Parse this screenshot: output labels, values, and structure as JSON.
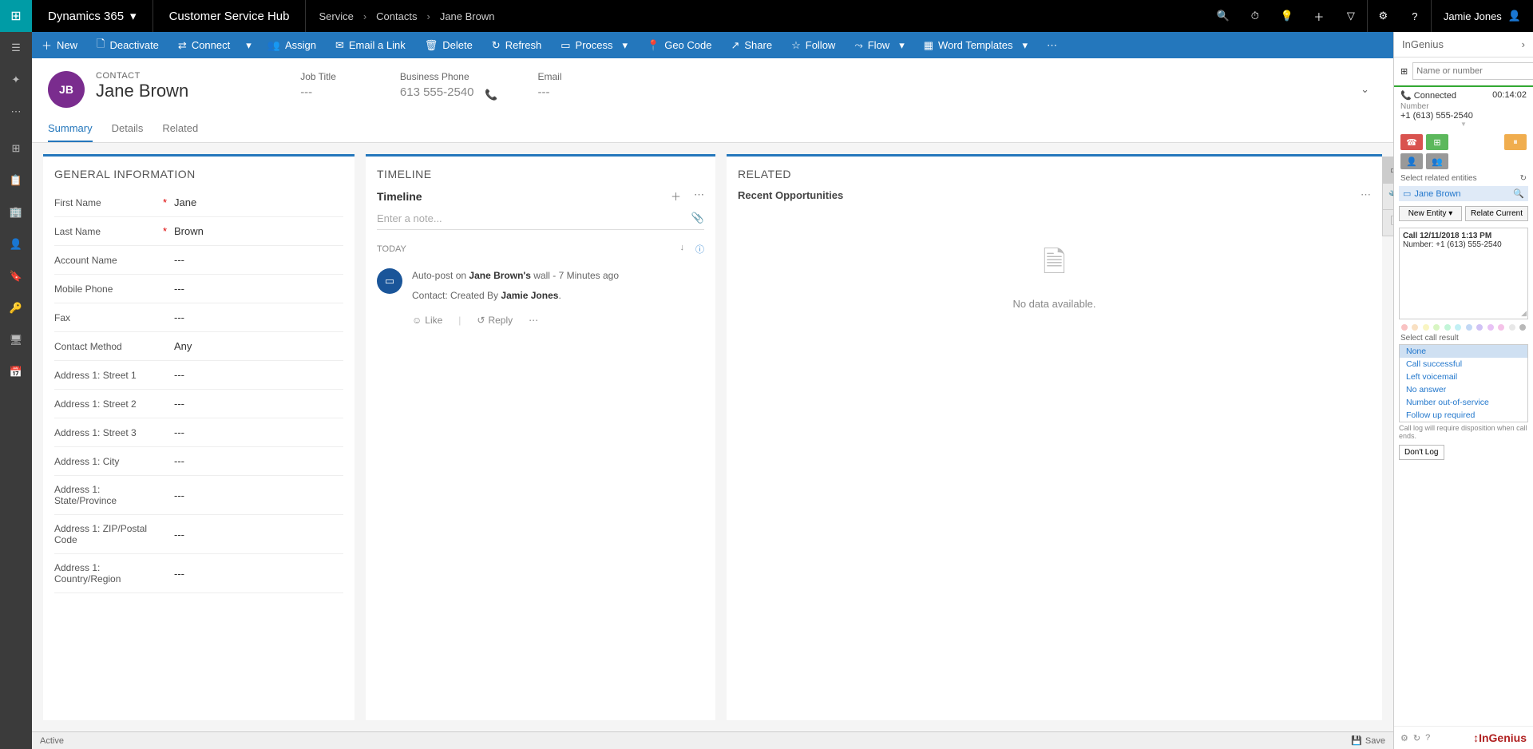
{
  "top": {
    "app": "Dynamics 365",
    "hub": "Customer Service Hub",
    "breadcrumb": [
      "Service",
      "Contacts",
      "Jane Brown"
    ],
    "user": "Jamie Jones"
  },
  "commands": [
    "New",
    "Deactivate",
    "Connect",
    "Assign",
    "Email a Link",
    "Delete",
    "Refresh",
    "Process",
    "Geo Code",
    "Share",
    "Follow",
    "Flow",
    "Word Templates"
  ],
  "record": {
    "entity": "CONTACT",
    "name": "Jane Brown",
    "initials": "JB",
    "header_fields": [
      {
        "label": "Job Title",
        "value": "---"
      },
      {
        "label": "Business Phone",
        "value": "613 555-2540"
      },
      {
        "label": "Email",
        "value": "---"
      }
    ]
  },
  "tabs": [
    "Summary",
    "Details",
    "Related"
  ],
  "general": {
    "title": "GENERAL INFORMATION",
    "fields": [
      {
        "label": "First Name",
        "req": true,
        "value": "Jane"
      },
      {
        "label": "Last Name",
        "req": true,
        "value": "Brown"
      },
      {
        "label": "Account Name",
        "req": false,
        "value": "---"
      },
      {
        "label": "Mobile Phone",
        "req": false,
        "value": "---"
      },
      {
        "label": "Fax",
        "req": false,
        "value": "---"
      },
      {
        "label": "Contact Method",
        "req": false,
        "value": "Any"
      },
      {
        "label": "Address 1: Street 1",
        "req": false,
        "value": "---"
      },
      {
        "label": "Address 1: Street 2",
        "req": false,
        "value": "---"
      },
      {
        "label": "Address 1: Street 3",
        "req": false,
        "value": "---"
      },
      {
        "label": "Address 1: City",
        "req": false,
        "value": "---"
      },
      {
        "label": "Address 1: State/Province",
        "req": false,
        "value": "---"
      },
      {
        "label": "Address 1: ZIP/Postal Code",
        "req": false,
        "value": "---"
      },
      {
        "label": "Address 1: Country/Region",
        "req": false,
        "value": "---"
      }
    ]
  },
  "timeline": {
    "title": "TIMELINE",
    "subtitle": "Timeline",
    "note_ph": "Enter a note...",
    "today": "TODAY",
    "post": {
      "prefix": "Auto-post on ",
      "subject": "Jane Brown's",
      "suffix": " wall -  7 Minutes ago",
      "line2a": "Contact: Created By ",
      "line2b": "Jamie Jones",
      "like": "Like",
      "reply": "Reply"
    }
  },
  "related": {
    "title": "RELATED",
    "section": "Recent Opportunities",
    "nodata": "No data available."
  },
  "ingenius": {
    "title": "InGenius",
    "search_ph": "Name or number",
    "status": "Connected",
    "timer": "00:14:02",
    "num_label": "Number",
    "number": "+1 (613) 555-2540",
    "entities_lbl": "Select related entities",
    "entity": "Jane Brown",
    "new_entity": "New Entity",
    "relate": "Relate Current",
    "log_title": "Call 12/11/2018 1:13 PM",
    "log_number": "Number: +1 (613) 555-2540",
    "result_lbl": "Select call result",
    "results": [
      "None",
      "Call successful",
      "Left voicemail",
      "No answer",
      "Number out-of-service",
      "Follow up required"
    ],
    "hint": "Call log will require disposition when call ends.",
    "dontlog": "Don't Log",
    "brand": "InGenius"
  },
  "status": {
    "state": "Active",
    "save": "Save"
  },
  "dot_colors": [
    "#f9c2c2",
    "#f9e0c2",
    "#f9f5c2",
    "#d8f5c2",
    "#c2f5d8",
    "#c2f0f5",
    "#c2d8f5",
    "#d0c2f5",
    "#e8c2f5",
    "#f5c2e8",
    "#e8e8e8",
    "#b8b8b8"
  ]
}
